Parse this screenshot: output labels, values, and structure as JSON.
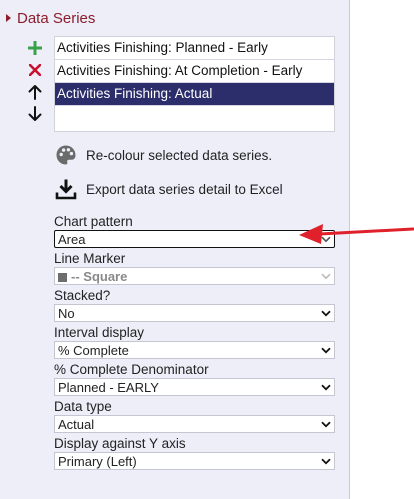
{
  "section": {
    "title": "Data Series",
    "expanded": true
  },
  "series_list": {
    "items": [
      {
        "label": "Activities Finishing: Planned - Early",
        "selected": false
      },
      {
        "label": "Activities Finishing: At Completion - Early",
        "selected": false
      },
      {
        "label": "Activities Finishing: Actual",
        "selected": true
      }
    ],
    "selected_color": "#2c2e6b"
  },
  "tools": {
    "add_icon": "plus-icon",
    "remove_icon": "close-icon",
    "move_up_icon": "arrow-up-icon",
    "move_down_icon": "arrow-down-icon",
    "add_color": "#3aa14a",
    "remove_color": "#c8102e"
  },
  "actions": {
    "recolour_label": "Re-colour selected data series.",
    "recolour_icon": "palette-icon",
    "export_label": "Export data series detail to Excel",
    "export_icon": "download-icon"
  },
  "fields": {
    "chart_pattern": {
      "label": "Chart pattern",
      "value": "Area"
    },
    "line_marker": {
      "label": "Line Marker",
      "value": "-- Square"
    },
    "stacked": {
      "label": "Stacked?",
      "value": "No"
    },
    "interval_display": {
      "label": "Interval display",
      "value": "% Complete"
    },
    "complete_denominator": {
      "label": "% Complete Denominator",
      "value": "Planned - EARLY"
    },
    "data_type": {
      "label": "Data type",
      "value": "Actual"
    },
    "y_axis": {
      "label": "Display against Y axis",
      "value": "Primary (Left)"
    }
  },
  "annotation": {
    "arrow_color": "#e0202a"
  },
  "colors": {
    "header": "#8b1d2c",
    "panel_bg": "#eeeef9"
  }
}
